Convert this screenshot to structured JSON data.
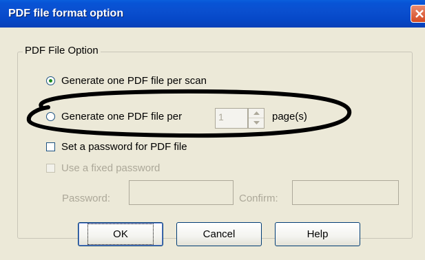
{
  "window": {
    "title": "PDF file format option"
  },
  "group": {
    "legend": "PDF File Option"
  },
  "options": {
    "per_scan_label": "Generate one PDF file per scan",
    "per_pages_label": "Generate one PDF file per",
    "pages_value": "1",
    "pages_suffix": "page(s)",
    "set_password_label": "Set a password for PDF file",
    "fixed_password_label": "Use a fixed password",
    "password_label": "Password:",
    "confirm_label": "Confirm:"
  },
  "buttons": {
    "ok": "OK",
    "cancel": "Cancel",
    "help": "Help"
  },
  "colors": {
    "title_bar": "#0a4fcf",
    "dialog_bg": "#ece9d8",
    "annotation_ellipse": "#000000"
  },
  "icons": [
    "close-icon",
    "spin-up-icon",
    "spin-down-icon"
  ]
}
